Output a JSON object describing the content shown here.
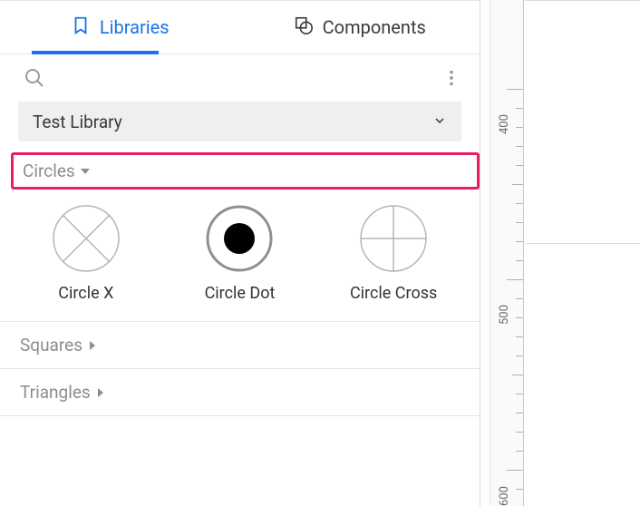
{
  "tabs": {
    "libraries": "Libraries",
    "components": "Components",
    "active": "libraries"
  },
  "library_select": {
    "value": "Test Library"
  },
  "groups": {
    "circles": {
      "label": "Circles",
      "expanded": true,
      "items": [
        {
          "label": "Circle X",
          "icon": "circle-x"
        },
        {
          "label": "Circle Dot",
          "icon": "circle-dot"
        },
        {
          "label": "Circle Cross",
          "icon": "circle-cross"
        }
      ]
    },
    "squares": {
      "label": "Squares",
      "expanded": false
    },
    "triangles": {
      "label": "Triangles",
      "expanded": false
    }
  },
  "ruler": {
    "labels": [
      "400",
      "500",
      "600"
    ]
  }
}
